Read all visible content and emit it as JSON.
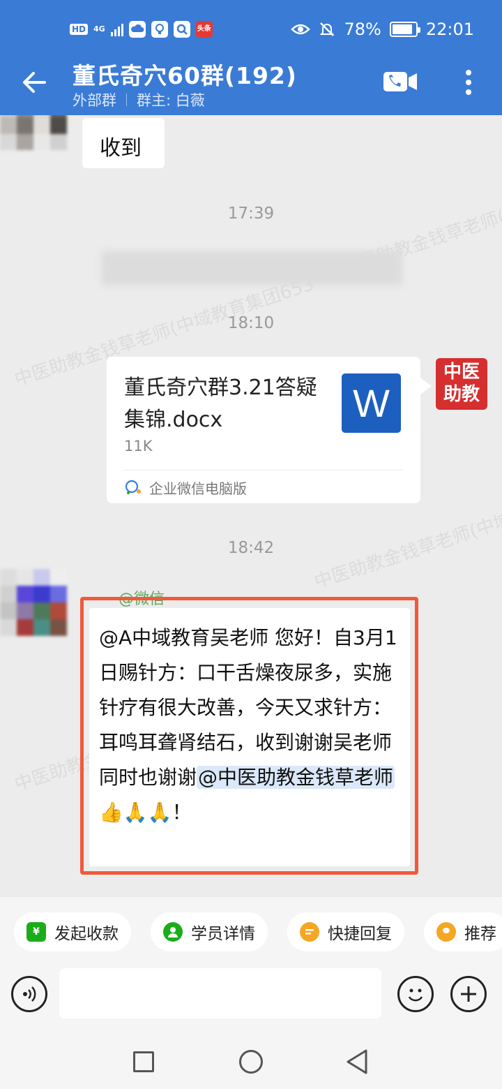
{
  "status_bar": {
    "hd": "HD",
    "network": "4G",
    "toutiao_badge": "头条",
    "battery": "78%",
    "battery_level": 0.78,
    "time": "22:01"
  },
  "header": {
    "title": "董氏奇穴60群(192)",
    "group_type": "外部群",
    "owner": "群主: 白薇"
  },
  "chat": {
    "messages": [
      {
        "type": "text",
        "direction": "received",
        "text": "收到"
      },
      {
        "type": "time",
        "text": "17:39"
      },
      {
        "type": "time",
        "text": "18:10"
      },
      {
        "type": "file",
        "direction": "sent",
        "file_name": "董氏奇穴群3.21答疑集锦.docx",
        "file_size": "11K",
        "file_icon_letter": "W",
        "source": "企业微信电脑版"
      },
      {
        "type": "time",
        "text": "18:42"
      },
      {
        "type": "text",
        "direction": "received",
        "sender_tag": "@微信",
        "text_main": "@A中域教育吴老师 您好！自3月1日赐针方：口干舌燥夜尿多，实施针疗有很大改善，今天又求针方：耳鸣耳聋肾结石，收到谢谢吴老师同时也谢谢",
        "mention": "@中医助教金钱草老师",
        "emojis": "👍🙏🙏",
        "text_end": "！"
      }
    ],
    "brand_avatar": {
      "line1": "中医",
      "line2": "助教"
    },
    "watermark": "中医助教金钱草老师(中域教育集团653"
  },
  "quick_actions": [
    {
      "label": "发起收款",
      "icon": "payment-icon",
      "color": "#1aad19"
    },
    {
      "label": "学员详情",
      "icon": "user-detail-icon",
      "color": "#1aad19"
    },
    {
      "label": "快捷回复",
      "icon": "quick-reply-icon",
      "color": "#f5a623"
    },
    {
      "label": "推荐",
      "icon": "recommend-icon",
      "color": "#f5a623"
    }
  ],
  "input": {
    "placeholder": ""
  },
  "colors": {
    "header": "#3a7bd5",
    "highlight": "#f05a3a",
    "word": "#1d5fbf",
    "brand": "#d62f2f"
  }
}
